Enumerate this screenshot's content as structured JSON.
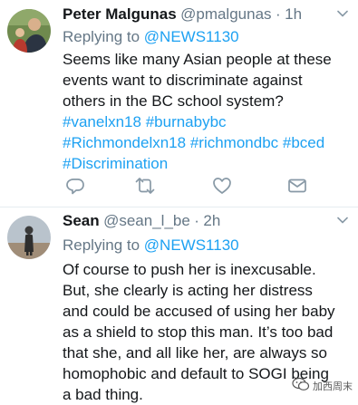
{
  "tweets": [
    {
      "name": "Peter Malgunas",
      "handle": "@pmalgunas",
      "separator": "·",
      "time": "1h",
      "reply_prefix": "Replying to",
      "reply_to": "@NEWS1130",
      "text_line1": "Seems like many Asian people at these",
      "text_line2": "events want to discriminate against",
      "text_line3": "others in the BC school system?",
      "hashtags": [
        "#vanelxn18",
        "#burnabybc",
        "#Richmondelxn18",
        "#richmondbc",
        "#bced",
        "#Discrimination"
      ],
      "actions": {
        "reply_icon": "reply-icon",
        "retweet_icon": "retweet-icon",
        "like_icon": "heart-icon",
        "message_icon": "envelope-icon"
      }
    },
    {
      "name": "Sean",
      "handle": "@sean_l_be",
      "separator": "·",
      "time": "2h",
      "reply_prefix": "Replying to",
      "reply_to": "@NEWS1130",
      "lines": [
        "Of course to push her is inexcusable.",
        "But, she clearly is acting her distress",
        "and could be accused of using her baby",
        "as a shield to stop this man. It’s too bad",
        "that she, and all like her, are always so",
        "homophobic and default to SOGI being",
        "a bad thing."
      ]
    }
  ],
  "watermark": {
    "text": "加西周末",
    "icon": "wechat-icon"
  },
  "colors": {
    "link": "#1da1f2",
    "secondary": "#657786",
    "primary_text": "#14171a",
    "divider": "#e6ecf0"
  }
}
